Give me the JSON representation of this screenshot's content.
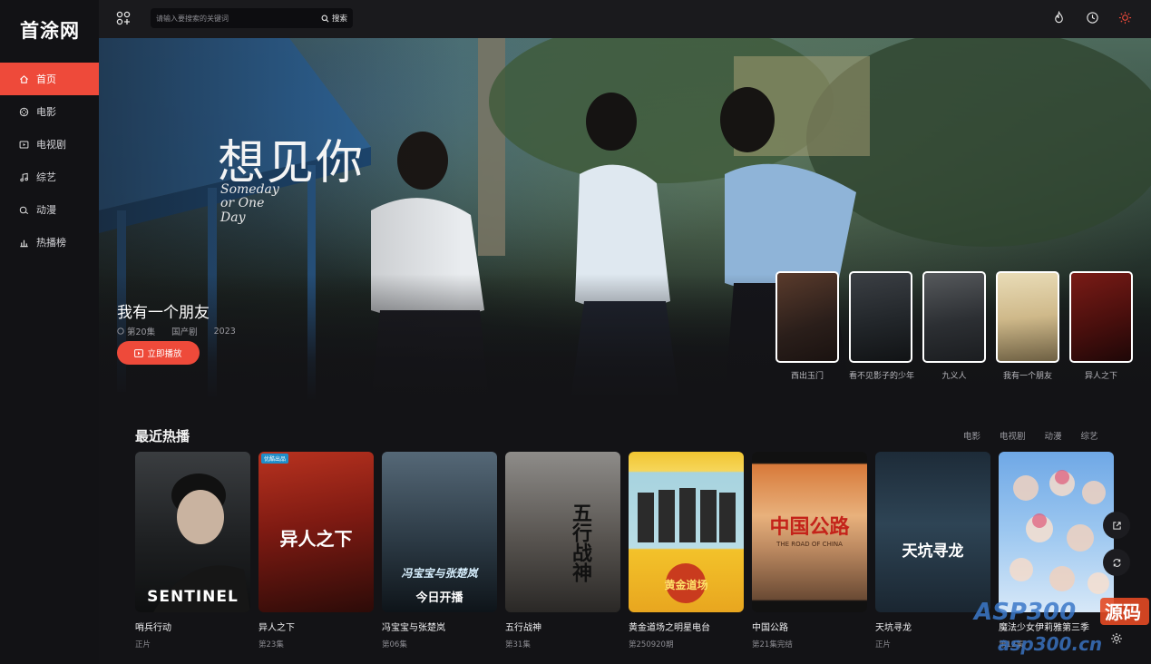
{
  "app": {
    "logo": "首涂网"
  },
  "sidebar": {
    "items": [
      {
        "label": "首页",
        "icon": "home-icon",
        "active": true
      },
      {
        "label": "电影",
        "icon": "film-reel-icon",
        "active": false
      },
      {
        "label": "电视剧",
        "icon": "tv-icon",
        "active": false
      },
      {
        "label": "综艺",
        "icon": "music-note-icon",
        "active": false
      },
      {
        "label": "动漫",
        "icon": "anime-icon",
        "active": false
      },
      {
        "label": "热播榜",
        "icon": "chart-icon",
        "active": false
      }
    ]
  },
  "topbar": {
    "search_placeholder": "请输入要搜索的关键词",
    "search_button": "搜索",
    "icons": [
      "apps-grid-icon",
      "fire-icon",
      "history-clock-icon",
      "theme-sun-icon"
    ]
  },
  "hero": {
    "logo_zh": "想见你",
    "logo_en": "Someday or One Day",
    "title": "我有一个朋友",
    "meta": [
      "第20集",
      "国产剧",
      "2023"
    ],
    "play_label": "立即播放",
    "thumbs": [
      {
        "label": "西出玉门"
      },
      {
        "label": "看不见影子的少年"
      },
      {
        "label": "九义人"
      },
      {
        "label": "我有一个朋友"
      },
      {
        "label": "异人之下"
      }
    ]
  },
  "section": {
    "title": "最近热播",
    "tabs": [
      "电影",
      "电视剧",
      "动漫",
      "综艺"
    ],
    "cards": [
      {
        "title": "哨兵行动",
        "sub": "正片",
        "poster_text": "SENTINEL"
      },
      {
        "title": "异人之下",
        "sub": "第23集",
        "poster_text": "异人之下",
        "badge": "优酷出品"
      },
      {
        "title": "冯宝宝与张楚岚",
        "sub": "第06集",
        "poster_text": "冯宝宝与张楚岚",
        "poster_text2": "今日开播"
      },
      {
        "title": "五行战神",
        "sub": "第31集",
        "poster_text": "五行战神"
      },
      {
        "title": "黄金道场之明星电台",
        "sub": "第250920期",
        "poster_text": "黄金道场"
      },
      {
        "title": "中国公路",
        "sub": "第21集完结",
        "poster_text": "中国公路",
        "poster_text2": "THE ROAD OF CHINA"
      },
      {
        "title": "天坑寻龙",
        "sub": "正片",
        "poster_text": "天坑寻龙"
      },
      {
        "title": "魔法少女伊莉雅第三季",
        "sub": "第12集",
        "poster_text": ""
      }
    ]
  },
  "floating": [
    "share-icon",
    "refresh-icon",
    "light-icon"
  ],
  "watermark": {
    "line1": "ASP300",
    "line2": "源码",
    "url": "asp300.cn"
  }
}
